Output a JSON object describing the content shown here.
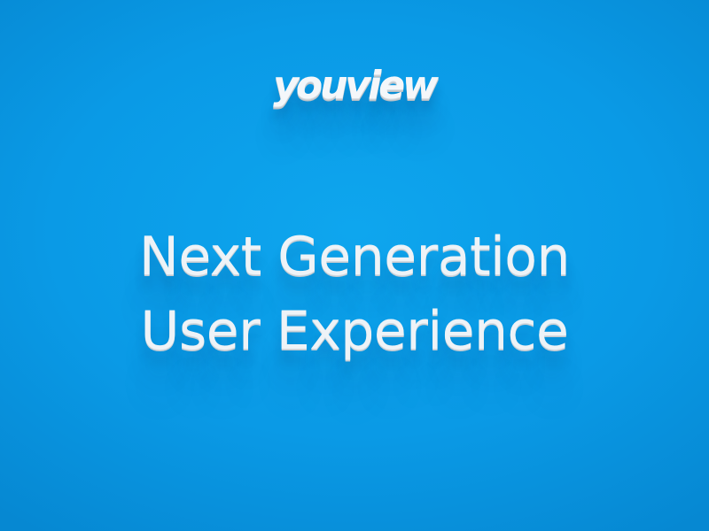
{
  "logo": {
    "text": "youview"
  },
  "headline": {
    "line1": "Next Generation",
    "line2": "User Experience"
  },
  "colors": {
    "background": "#0a9ae6",
    "text": "#eef3f7"
  }
}
